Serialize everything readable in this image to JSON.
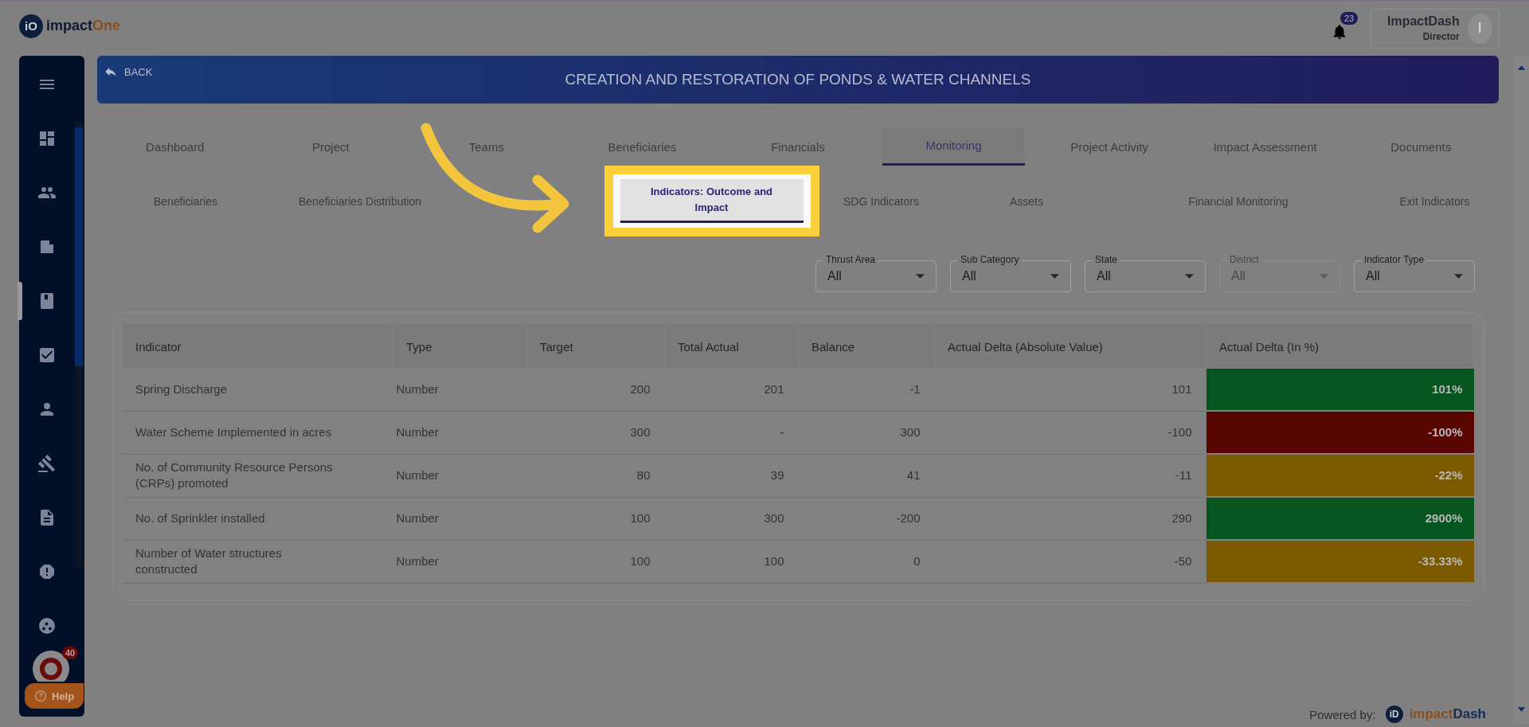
{
  "brand": {
    "mark": "iO",
    "name_a": "impact",
    "name_b": "One"
  },
  "notifications": {
    "count": "23"
  },
  "user": {
    "name": "ImpactDash",
    "role": "Director",
    "initial": "I"
  },
  "sidebar": {
    "items": [
      {
        "selected": false
      },
      {
        "selected": false
      },
      {
        "selected": false
      },
      {
        "selected": false
      },
      {
        "selected": true
      },
      {
        "selected": false
      },
      {
        "selected": false
      },
      {
        "selected": false
      },
      {
        "selected": false
      },
      {
        "selected": false
      },
      {
        "selected": false
      }
    ],
    "chat_badge": "40",
    "help": "Help"
  },
  "header": {
    "back": "BACK",
    "title": "CREATION AND RESTORATION OF PONDS & WATER CHANNELS"
  },
  "tabs": [
    {
      "label": "Dashboard",
      "selected": false
    },
    {
      "label": "Project",
      "selected": false
    },
    {
      "label": "Teams",
      "selected": false
    },
    {
      "label": "Beneficiaries",
      "selected": false
    },
    {
      "label": "Financials",
      "selected": false
    },
    {
      "label": "Monitoring",
      "selected": true
    },
    {
      "label": "Project Activity",
      "selected": false
    },
    {
      "label": "Impact Assessment",
      "selected": false
    },
    {
      "label": "Documents",
      "selected": false
    }
  ],
  "subtabs": [
    {
      "label": "Beneficiaries",
      "selected": false,
      "highlighted": false
    },
    {
      "label": "Beneficiaries Distribution",
      "selected": false,
      "highlighted": false
    },
    {
      "label": "Indicators: Outcome and Impact",
      "selected": true,
      "highlighted": true
    },
    {
      "label": "SDG Indicators",
      "selected": false,
      "highlighted": false
    },
    {
      "label": "Assets",
      "selected": false,
      "highlighted": false
    },
    {
      "label": "Financial Monitoring",
      "selected": false,
      "highlighted": false
    },
    {
      "label": "Exit Indicators",
      "selected": false,
      "highlighted": false
    }
  ],
  "filters": [
    {
      "label": "Thrust Area",
      "value": "All",
      "disabled": false
    },
    {
      "label": "Sub Category",
      "value": "All",
      "disabled": false
    },
    {
      "label": "State",
      "value": "All",
      "disabled": false
    },
    {
      "label": "District",
      "value": "All",
      "disabled": true
    },
    {
      "label": "Indicator Type",
      "value": "All",
      "disabled": false
    }
  ],
  "table": {
    "columns": [
      "Indicator",
      "Type",
      "Target",
      "Total Actual",
      "Balance",
      "Actual Delta (Absolute Value)",
      "Actual Delta (In %)"
    ],
    "rows": [
      {
        "cells": [
          "Spring Discharge",
          "Number",
          "200",
          "201",
          "-1",
          "101",
          "101%"
        ],
        "color": "#08561f"
      },
      {
        "cells": [
          "Water Scheme Implemented in acres",
          "Number",
          "300",
          "-",
          "300",
          "-100",
          "-100%"
        ],
        "color": "#5a0600"
      },
      {
        "cells": [
          "No. of Community Resource Persons (CRPs) promoted",
          "Number",
          "80",
          "39",
          "41",
          "-11",
          "-22%"
        ],
        "color": "#7b5900"
      },
      {
        "cells": [
          "No. of Sprinkler installed",
          "Number",
          "100",
          "300",
          "-200",
          "290",
          "2900%"
        ],
        "color": "#08561f"
      },
      {
        "cells": [
          "Number of Water structures constructed",
          "Number",
          "100",
          "100",
          "0",
          "-50",
          "-33.33%"
        ],
        "color": "#7b5900"
      }
    ]
  },
  "footer": {
    "label": "Powered by:",
    "mark": "iD",
    "name_a": "impact",
    "name_b": "Dash"
  }
}
